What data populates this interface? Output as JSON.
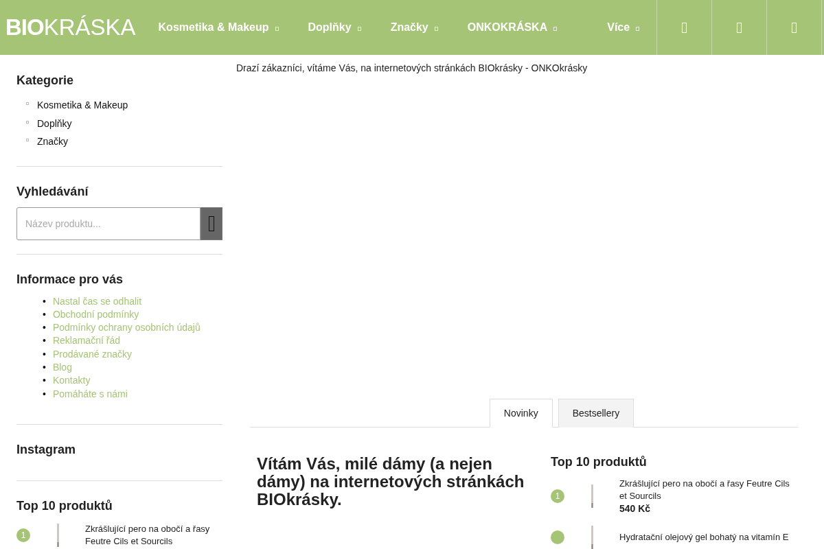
{
  "header": {
    "logo": "**BIO**KRÁSKA",
    "nav": [
      {
        "label": "Kosmetika & Makeup",
        "dropdown": true
      },
      {
        "label": "Doplňky",
        "dropdown": true
      },
      {
        "label": "Značky",
        "dropdown": true
      },
      {
        "label": "ONKOKRÁSKA",
        "dropdown": true
      },
      {
        "label": "Více",
        "dropdown": true
      }
    ],
    "icon_buttons": [
      {
        "kind": "glyph"
      },
      {
        "kind": "glyph"
      },
      {
        "kind": "glyph"
      }
    ]
  },
  "sidebar": {
    "categories": {
      "title": "Kategorie",
      "items": [
        "Kosmetika & Makeup",
        "Doplňky",
        "Značky"
      ]
    },
    "search": {
      "title": "Vyhledávání",
      "placeholder": "Název produktu..."
    },
    "info": {
      "title": "Informace pro vás",
      "marker": "•",
      "links": [
        "Nastal čas se odhalit",
        "Obchodní podmínky",
        "Podmínky ochrany osobních údajů",
        "Reklamační řád",
        "Prodávané značky",
        "Blog",
        "Kontakty",
        "Pomáháte s námi"
      ]
    },
    "instagram": {
      "title": "Instagram"
    },
    "top": {
      "title": "Top 10 produktů",
      "products": [
        {
          "rank": "1",
          "name": "Zkrášlující pero na obočí a řasy Feutre Cils et Sourcils"
        }
      ]
    }
  },
  "main": {
    "welcome": "Drazí zákazníci, vítáme Vás, na internetových stránkách BIOkrásky - ONKOkrásky",
    "tabs": [
      {
        "label": "Novinky",
        "selected": true
      },
      {
        "label": "Bestsellery",
        "selected": false
      }
    ],
    "heading": "Vítám Vás, milé dámy (a nejen dámy) na internetových stránkách BIOkrásky.",
    "top": {
      "title": "Top 10 produktů",
      "products": [
        {
          "rank": "1",
          "name": "Zkrášlující pero na obočí a řasy Feutre Cils et Sourcils",
          "price": "540 Kč"
        },
        {
          "name": "Hydratační olejový gel bohatý na vitamín E"
        }
      ]
    }
  }
}
